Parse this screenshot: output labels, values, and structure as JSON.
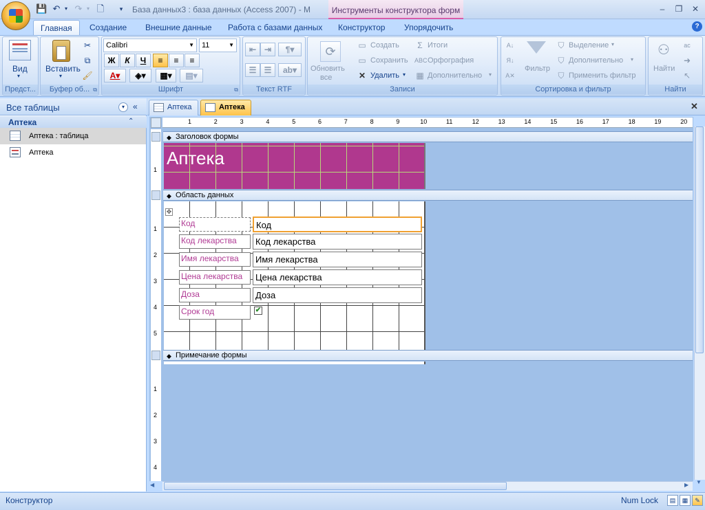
{
  "window": {
    "title": "База данных3 : база данных (Access 2007) - М",
    "context_title": "Инструменты конструктора форм"
  },
  "tabs": [
    "Главная",
    "Создание",
    "Внешние данные",
    "Работа с базами данных",
    "Конструктор",
    "Упорядочить"
  ],
  "ribbon": {
    "views": {
      "button": "Вид",
      "label": "Предст..."
    },
    "clipboard": {
      "paste": "Вставить",
      "label": "Буфер об..."
    },
    "font": {
      "family": "Calibri",
      "size": "11",
      "bold": "Ж",
      "italic": "К",
      "underline": "Ч",
      "label": "Шрифт"
    },
    "rtf": {
      "label": "Текст RTF"
    },
    "records": {
      "refresh": "Обновить",
      "refresh2": "все",
      "new": "Создать",
      "save": "Сохранить",
      "delete": "Удалить",
      "totals": "Итоги",
      "spelling": "Орфография",
      "more": "Дополнительно",
      "label": "Записи"
    },
    "sort": {
      "filter": "Фильтр",
      "selection": "Выделение",
      "advanced": "Дополнительно",
      "toggle": "Применить фильтр",
      "label": "Сортировка и фильтр"
    },
    "find": {
      "button": "Найти",
      "label": "Найти"
    }
  },
  "nav": {
    "title": "Все таблицы",
    "group": "Аптека",
    "items": [
      "Аптека : таблица",
      "Аптека"
    ]
  },
  "doctabs": [
    "Аптека",
    "Аптека"
  ],
  "form": {
    "header_band": "Заголовок формы",
    "header_title": "Аптека",
    "detail_band": "Область данных",
    "footer_band": "Примечание формы",
    "labels": [
      "Код",
      "Код лекарства",
      "Имя лекарства",
      "Цена лекарства",
      "Доза",
      "Срок год"
    ],
    "fields": [
      "Код",
      "Код лекарства",
      "Имя лекарства",
      "Цена лекарства",
      "Доза"
    ],
    "checkbox_mark": "✔"
  },
  "ruler_top": [
    "1",
    "2",
    "3",
    "4",
    "5",
    "6",
    "7",
    "8",
    "9",
    "10",
    "11",
    "12",
    "13",
    "14",
    "15",
    "16",
    "17",
    "18",
    "19",
    "20"
  ],
  "ruler_left_header": [
    "1"
  ],
  "ruler_left_data": [
    "1",
    "2",
    "3",
    "4",
    "5"
  ],
  "ruler_left_footer": [
    "1",
    "2",
    "3",
    "4"
  ],
  "status": {
    "mode": "Конструктор",
    "numlock": "Num Lock"
  }
}
